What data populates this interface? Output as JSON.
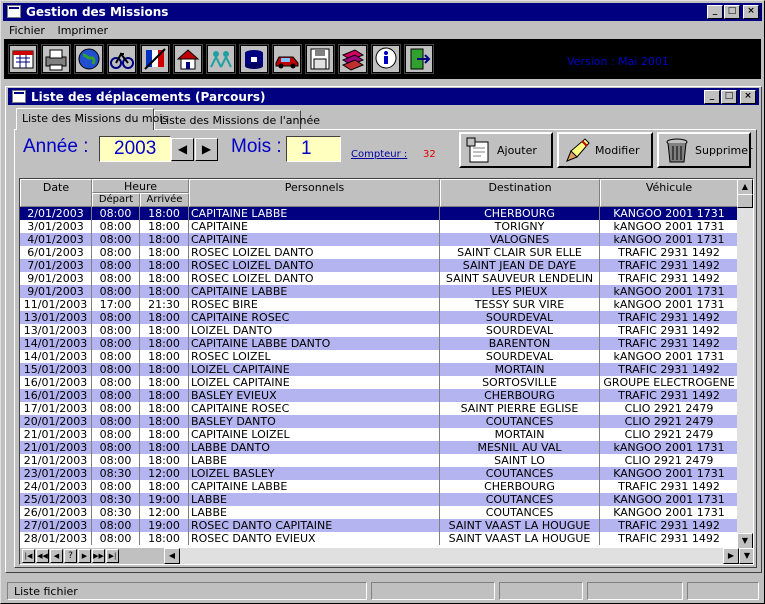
{
  "app": {
    "title": "Gestion des Missions"
  },
  "menu": [
    "Fichier",
    "Imprimer"
  ],
  "toolbar": {
    "icons": [
      "calendar-icon",
      "printer-icon",
      "globe-icon",
      "bicycle-icon",
      "flag-icon",
      "house-icon",
      "people-icon",
      "pot-icon",
      "car-icon",
      "floppy-icon",
      "books-icon",
      "info-icon",
      "exit-door-icon"
    ],
    "version_text": "Version : Mai 2001"
  },
  "window": {
    "title": "Liste des déplacements (Parcours)",
    "tabs": [
      "Liste des Missions du mois",
      "Liste des Missions de l'année"
    ]
  },
  "filters": {
    "year_label": "Année :",
    "year_value": "2003",
    "month_label": "Mois :",
    "month_value": "1",
    "counter_label": "Compteur :",
    "counter_value": "32"
  },
  "actions": {
    "add": "Ajouter",
    "edit": "Modifier",
    "delete": "Supprimer"
  },
  "table": {
    "headers": {
      "date": "Date",
      "heure": "Heure",
      "depart": "Départ",
      "arrivee": "Arrivée",
      "personnels": "Personnels",
      "destination": "Destination",
      "vehicule": "Véhicule"
    },
    "rows": [
      [
        "2/01/2003",
        "08:00",
        "18:00",
        "CAPITAINE   LABBE",
        "CHERBOURG",
        "KANGOO 2001 1731"
      ],
      [
        "3/01/2003",
        "08:00",
        "18:00",
        "CAPITAINE",
        "TORIGNY",
        "kANGOO 2001 1731"
      ],
      [
        "4/01/2003",
        "08:00",
        "18:00",
        "CAPITAINE",
        "VALOGNES",
        "kANGOO 2001 1731"
      ],
      [
        "6/01/2003",
        "08:00",
        "18:00",
        "ROSEC   LOIZEL   DANTO",
        "SAINT CLAIR SUR ELLE",
        "TRAFIC 2931 1492"
      ],
      [
        "7/01/2003",
        "08:00",
        "18:00",
        "ROSEC   LOIZEL   DANTO",
        "SAINT JEAN DE DAYE",
        "TRAFIC 2931 1492"
      ],
      [
        "9/01/2003",
        "08:00",
        "18:00",
        "ROSEC   LOIZEL   DANTO",
        "SAINT SAUVEUR LENDELIN",
        "TRAFIC 2931 1492"
      ],
      [
        "9/01/2003",
        "08:00",
        "18:00",
        "CAPITAINE   LABBE",
        "LES PIEUX",
        "kANGOO 2001 1731"
      ],
      [
        "11/01/2003",
        "17:00",
        "21:30",
        "ROSEC   BIRE",
        "TESSY SUR VIRE",
        "kANGOO 2001 1731"
      ],
      [
        "13/01/2003",
        "08:00",
        "18:00",
        "CAPITAINE   ROSEC",
        "SOURDEVAL",
        "TRAFIC 2931 1492"
      ],
      [
        "13/01/2003",
        "08:00",
        "18:00",
        "LOIZEL   DANTO",
        "SOURDEVAL",
        "TRAFIC 2931 1492"
      ],
      [
        "14/01/2003",
        "08:00",
        "18:00",
        "CAPITAINE   LABBE   DANTO",
        "BARENTON",
        "TRAFIC 2931 1492"
      ],
      [
        "14/01/2003",
        "08:00",
        "18:00",
        "ROSEC   LOIZEL",
        "SOURDEVAL",
        "kANGOO 2001 1731"
      ],
      [
        "15/01/2003",
        "08:00",
        "18:00",
        "LOIZEL   CAPITAINE",
        "MORTAIN",
        "TRAFIC 2931 1492"
      ],
      [
        "16/01/2003",
        "08:00",
        "18:00",
        "LOIZEL   CAPITAINE",
        "SORTOSVILLE",
        "GROUPE ELECTROGENE"
      ],
      [
        "16/01/2003",
        "08:00",
        "18:00",
        "BASLEY   EVIEUX",
        "CHERBOURG",
        "TRAFIC 2931 1492"
      ],
      [
        "17/01/2003",
        "08:00",
        "18:00",
        "CAPITAINE   ROSEC",
        "SAINT PIERRE EGLISE",
        "CLIO 2921 2479"
      ],
      [
        "20/01/2003",
        "08:00",
        "18:00",
        "BASLEY   DANTO",
        "COUTANCES",
        "CLIO 2921 2479"
      ],
      [
        "21/01/2003",
        "08:00",
        "18:00",
        "CAPITAINE   LOIZEL",
        "MORTAIN",
        "CLIO 2921 2479"
      ],
      [
        "21/01/2003",
        "08:00",
        "18:00",
        "LABBE   DANTO",
        "MESNIL AU VAL",
        "kANGOO 2001 1731"
      ],
      [
        "21/01/2003",
        "08:00",
        "18:00",
        "LABBE",
        "SAINT LO",
        "CLIO 2921 2479"
      ],
      [
        "23/01/2003",
        "08:30",
        "12:00",
        "LOIZEL   BASLEY",
        "COUTANCES",
        "KANGOO 2001 1731"
      ],
      [
        "24/01/2003",
        "08:00",
        "18:00",
        "CAPITAINE   LABBE",
        "CHERBOURG",
        "TRAFIC 2931 1492"
      ],
      [
        "25/01/2003",
        "08:30",
        "19:00",
        "LABBE",
        "COUTANCES",
        "KANGOO 2001 1731"
      ],
      [
        "26/01/2003",
        "08:30",
        "12:00",
        "LABBE",
        "COUTANCES",
        "KANGOO 2001 1731"
      ],
      [
        "27/01/2003",
        "08:00",
        "19:00",
        "ROSEC   DANTO   CAPITAINE",
        "SAINT VAAST LA HOUGUE",
        "TRAFIC 2931 1492"
      ],
      [
        "28/01/2003",
        "08:00",
        "18:00",
        "ROSEC   DANTO   EVIEUX",
        "SAINT VAAST LA HOUGUE",
        "TRAFIC 2931 1492"
      ]
    ]
  },
  "status": {
    "text": "Liste fichier"
  },
  "colors": {
    "title_bar": "#000080",
    "accent_blue": "#0000c8",
    "row_alt": "#b4b4f0",
    "counter": "#e00000",
    "field_bg": "#ffffc0"
  }
}
